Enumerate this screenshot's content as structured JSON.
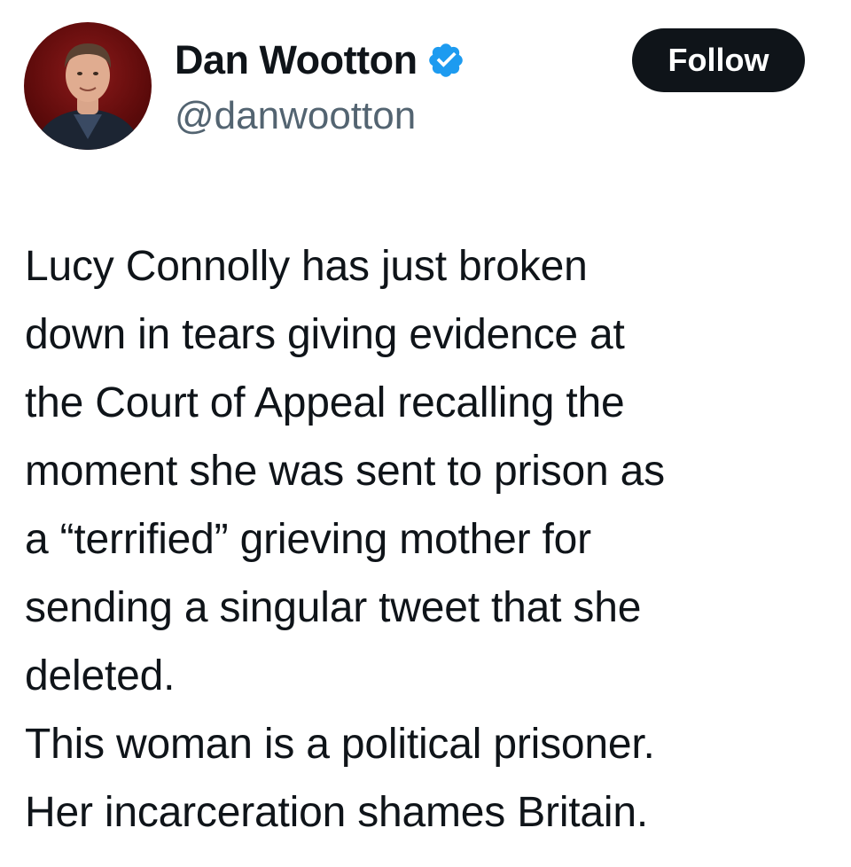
{
  "author": {
    "display_name": "Dan Wootton",
    "handle": "@danwootton",
    "verified": true,
    "verified_icon": "verified-badge-icon",
    "avatar_icon": "profile-photo"
  },
  "actions": {
    "follow_label": "Follow"
  },
  "tweet": {
    "lines": [
      "Lucy Connolly has just broken",
      "down in tears giving evidence at",
      "the Court of Appeal recalling the",
      "moment she was sent to prison as",
      "a “terrified” grieving mother for",
      "sending a singular tweet that she",
      "deleted.",
      "This woman is a political prisoner.",
      "Her incarceration shames Britain."
    ]
  },
  "colors": {
    "text_primary": "#0f1419",
    "text_secondary": "#536471",
    "follow_bg": "#0f1419",
    "follow_text": "#ffffff",
    "verified_blue": "#1d9bf0",
    "avatar_bg": "#7a1212"
  }
}
